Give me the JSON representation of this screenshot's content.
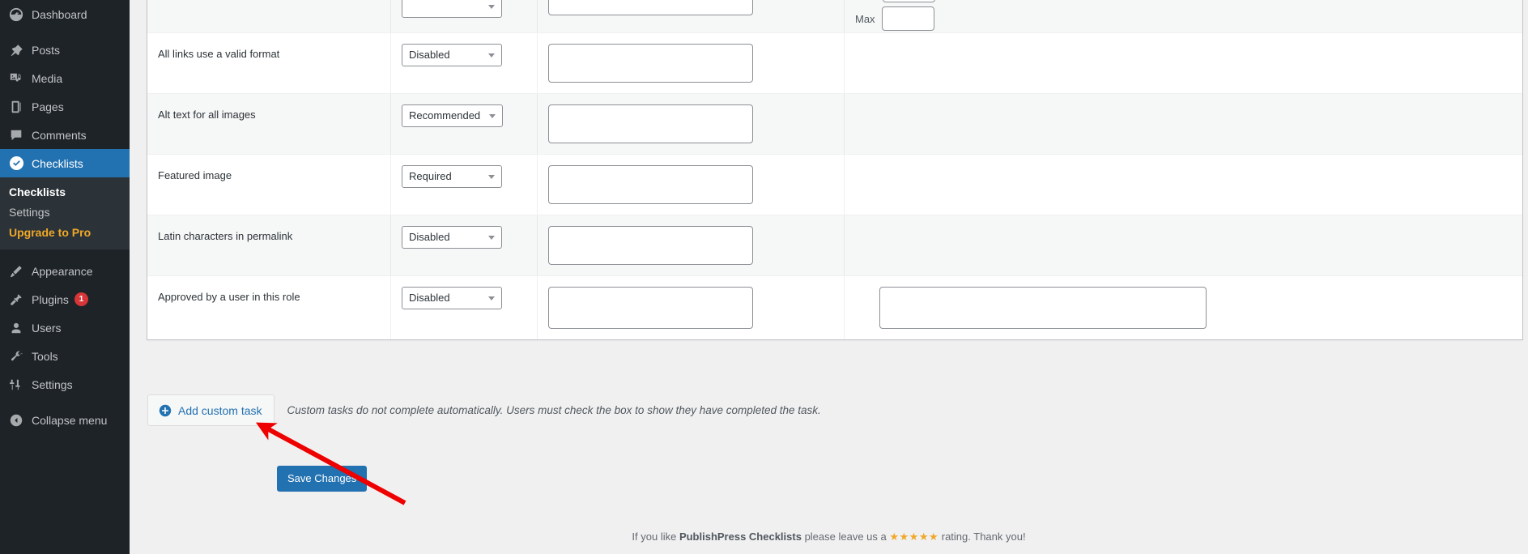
{
  "sidebar": {
    "items": [
      {
        "label": "Dashboard",
        "icon": "dashboard-icon",
        "name": "sidebar-item-dashboard"
      },
      {
        "label": "Posts",
        "icon": "pin-icon",
        "name": "sidebar-item-posts"
      },
      {
        "label": "Media",
        "icon": "media-icon",
        "name": "sidebar-item-media"
      },
      {
        "label": "Pages",
        "icon": "pages-icon",
        "name": "sidebar-item-pages"
      },
      {
        "label": "Comments",
        "icon": "comments-icon",
        "name": "sidebar-item-comments"
      },
      {
        "label": "Checklists",
        "icon": "checkmark-circle-icon",
        "name": "sidebar-item-checklists"
      },
      {
        "label": "Appearance",
        "icon": "brush-icon",
        "name": "sidebar-item-appearance"
      },
      {
        "label": "Plugins",
        "icon": "plug-icon",
        "name": "sidebar-item-plugins",
        "badge": "1"
      },
      {
        "label": "Users",
        "icon": "user-icon",
        "name": "sidebar-item-users"
      },
      {
        "label": "Tools",
        "icon": "wrench-icon",
        "name": "sidebar-item-tools"
      },
      {
        "label": "Settings",
        "icon": "sliders-icon",
        "name": "sidebar-item-settings"
      },
      {
        "label": "Collapse menu",
        "icon": "collapse-arrow-icon",
        "name": "sidebar-item-collapse"
      }
    ],
    "submenu": {
      "checklists": "Checklists",
      "settings": "Settings",
      "upgrade": "Upgrade to Pro"
    },
    "plugins_badge": "1",
    "active_item": "Checklists",
    "accent_color": "#2271b1",
    "background_color": "#1d2327",
    "submenu_background": "#2c3338",
    "pro_color": "#f0a828",
    "badge_color": "#d63638"
  },
  "table": {
    "rows": [
      {
        "name": "partial-top-row",
        "title": "",
        "status": "",
        "note": "",
        "max_label": "Max",
        "max_value": ""
      },
      {
        "name": "row-all-links-valid-format",
        "title": "All links use a valid format",
        "status": "Disabled",
        "note": ""
      },
      {
        "name": "row-alt-text-images",
        "title": "Alt text for all images",
        "status": "Recommended",
        "note": ""
      },
      {
        "name": "row-featured-image",
        "title": "Featured image",
        "status": "Required",
        "note": ""
      },
      {
        "name": "row-latin-characters-permalink",
        "title": "Latin characters in permalink",
        "status": "Disabled",
        "note": ""
      },
      {
        "name": "row-approved-by-user-role",
        "title": "Approved by a user in this role",
        "status": "Disabled",
        "note": "",
        "role_value": ""
      }
    ],
    "status_options": [
      "Disabled",
      "Recommended",
      "Required"
    ]
  },
  "actions": {
    "add_custom_task": "Add custom task",
    "add_custom_task_hint": "Custom tasks do not complete automatically. Users must check the box to show they have completed the task.",
    "save_changes": "Save Changes"
  },
  "footer": {
    "prefix": "If you like ",
    "plugin_name": "PublishPress Checklists",
    "middle": " please leave us a ",
    "stars": "★★★★★",
    "suffix": " rating. Thank you!"
  },
  "annotation": {
    "arrow_color": "#ee0000",
    "arrow_tip": "320,523",
    "arrow_tail": "500,621"
  }
}
